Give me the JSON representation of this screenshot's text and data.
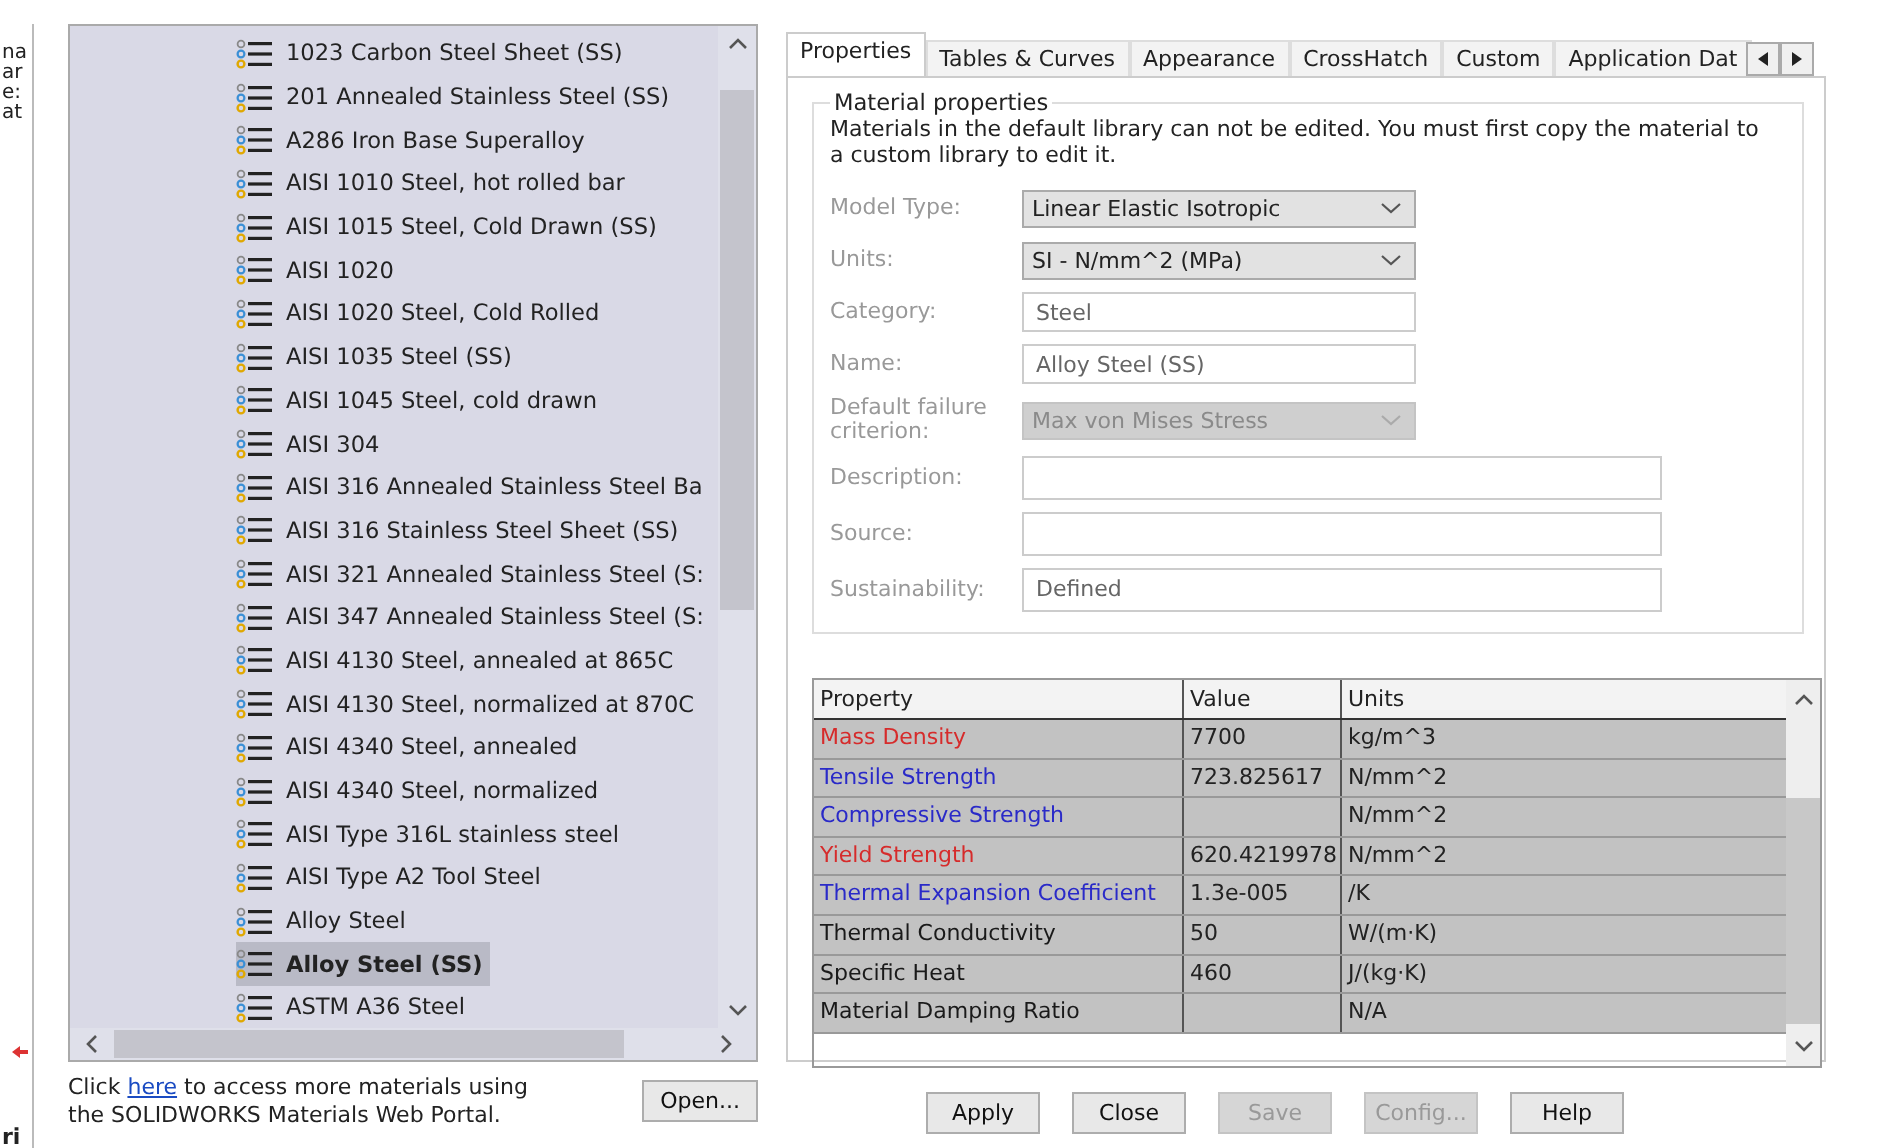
{
  "edge_fragments_top": [
    "na",
    "ar",
    "e:",
    "at"
  ],
  "edge_fragment_bottom": "ri",
  "materials": [
    {
      "label": "1023 Carbon Steel Sheet (SS)",
      "selected": false
    },
    {
      "label": "201 Annealed Stainless Steel (SS)",
      "selected": false
    },
    {
      "label": "A286 Iron Base Superalloy",
      "selected": false
    },
    {
      "label": "AISI 1010 Steel, hot rolled bar",
      "selected": false
    },
    {
      "label": "AISI 1015 Steel, Cold Drawn (SS)",
      "selected": false
    },
    {
      "label": "AISI 1020",
      "selected": false
    },
    {
      "label": "AISI 1020 Steel, Cold Rolled",
      "selected": false
    },
    {
      "label": "AISI 1035 Steel (SS)",
      "selected": false
    },
    {
      "label": "AISI 1045 Steel, cold drawn",
      "selected": false
    },
    {
      "label": "AISI 304",
      "selected": false
    },
    {
      "label": "AISI 316 Annealed Stainless Steel Ba",
      "selected": false
    },
    {
      "label": "AISI 316 Stainless Steel Sheet (SS)",
      "selected": false
    },
    {
      "label": "AISI 321 Annealed Stainless Steel (S:",
      "selected": false
    },
    {
      "label": "AISI 347 Annealed Stainless Steel (S:",
      "selected": false
    },
    {
      "label": "AISI 4130 Steel, annealed at 865C",
      "selected": false
    },
    {
      "label": "AISI 4130 Steel, normalized at 870C",
      "selected": false
    },
    {
      "label": "AISI 4340 Steel, annealed",
      "selected": false
    },
    {
      "label": "AISI 4340 Steel, normalized",
      "selected": false
    },
    {
      "label": "AISI Type 316L stainless steel",
      "selected": false
    },
    {
      "label": "AISI Type A2 Tool Steel",
      "selected": false
    },
    {
      "label": "Alloy Steel",
      "selected": false
    },
    {
      "label": "Alloy Steel (SS)",
      "selected": true
    },
    {
      "label": "ASTM A36 Steel",
      "selected": false
    }
  ],
  "footer": {
    "before": "Click ",
    "link": "here",
    "after": " to access more materials using the SOLIDWORKS Materials Web Portal.",
    "button": "Open..."
  },
  "tabs": [
    {
      "label": "Properties",
      "selected": true
    },
    {
      "label": "Tables & Curves",
      "selected": false
    },
    {
      "label": "Appearance",
      "selected": false
    },
    {
      "label": "CrossHatch",
      "selected": false
    },
    {
      "label": "Custom",
      "selected": false
    },
    {
      "label": "Application Dat",
      "selected": false
    }
  ],
  "group": {
    "title": "Material properties",
    "note": "Materials in the default library can not be edited. You must first copy the material to a custom library to edit it."
  },
  "fields": [
    {
      "label": "Model Type:",
      "kind": "dropdown",
      "value": "Linear Elastic Isotropic",
      "disabled": false
    },
    {
      "label": "Units:",
      "kind": "dropdown",
      "value": "SI - N/mm^2 (MPa)",
      "disabled": false
    },
    {
      "label": "Category:",
      "kind": "text",
      "value": "Steel"
    },
    {
      "label": "Name:",
      "kind": "text",
      "value": "Alloy Steel (SS)"
    },
    {
      "label": "Default failure criterion:",
      "kind": "dropdown",
      "value": "Max von Mises Stress",
      "disabled": true
    },
    {
      "label": "Description:",
      "kind": "long_text"
    },
    {
      "label": "Source:",
      "kind": "long_text"
    },
    {
      "label": "Sustainability:",
      "kind": "long_text",
      "value": "Defined"
    }
  ],
  "table": {
    "columns": [
      "Property",
      "Value",
      "Units"
    ],
    "rows": [
      {
        "property": "Mass Density",
        "color": "#d62b2b",
        "value": "7700",
        "units": "kg/m^3"
      },
      {
        "property": "Tensile Strength",
        "color": "#2a2ac8",
        "value": "723.825617",
        "units": "N/mm^2"
      },
      {
        "property": "Compressive Strength",
        "color": "#2a2ac8",
        "units": "N/mm^2"
      },
      {
        "property": "Yield Strength",
        "color": "#d62b2b",
        "value": "620.4219978",
        "units": "N/mm^2"
      },
      {
        "property": "Thermal Expansion Coefficient",
        "color": "#2a2ac8",
        "value": "1.3e-005",
        "units": "/K"
      },
      {
        "property": "Thermal Conductivity",
        "color": "#1a1a1a",
        "value": "50",
        "units": "W/(m·K)"
      },
      {
        "property": "Specific Heat",
        "color": "#1a1a1a",
        "value": "460",
        "units": "J/(kg·K)"
      },
      {
        "property": "Material Damping Ratio",
        "color": "#1a1a1a",
        "units": "N/A"
      }
    ]
  },
  "buttons": [
    {
      "label": "Apply",
      "disabled": false
    },
    {
      "label": "Close",
      "disabled": false
    },
    {
      "label": "Save",
      "disabled": true
    },
    {
      "label": "Config...",
      "disabled": true
    },
    {
      "label": "Help",
      "disabled": false
    }
  ]
}
